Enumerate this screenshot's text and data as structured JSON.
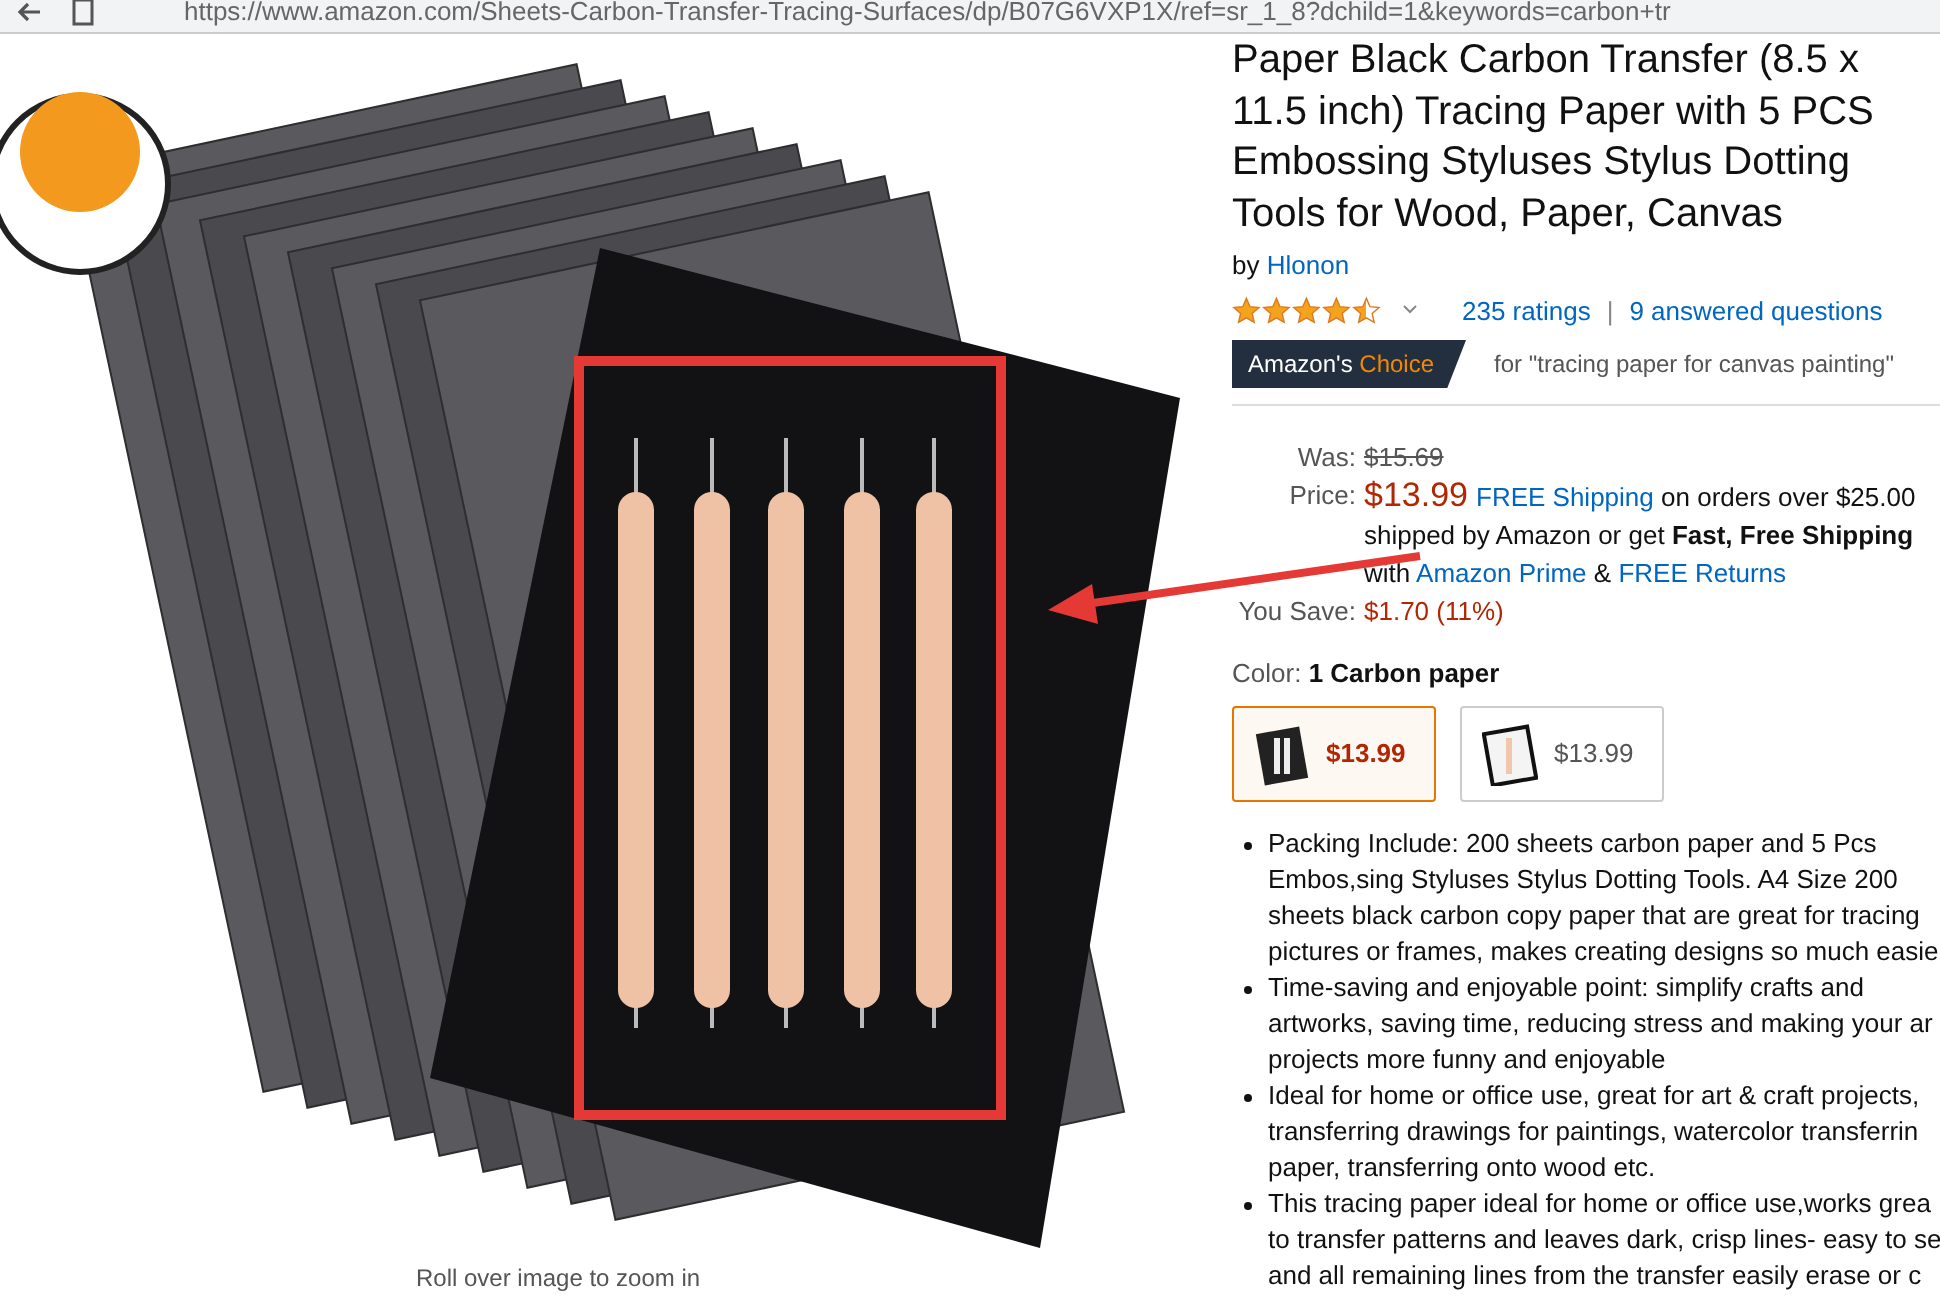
{
  "address_bar": {
    "url": "https://www.amazon.com/Sheets-Carbon-Transfer-Tracing-Surfaces/dp/B07G6VXP1X/ref=sr_1_8?dchild=1&keywords=carbon+tr"
  },
  "image": {
    "caption": "Roll over image to zoom in"
  },
  "product": {
    "title": "Paper Black Carbon Transfer (8.5 x 11.5 inch) Tracing Paper with 5 PCS Embossing Styluses Stylus Dotting Tools for Wood, Paper, Canvas",
    "by": "by",
    "brand": "Hlonon",
    "stars": 4.5,
    "ratings": "235 ratings",
    "separator": "|",
    "questions": "9 answered questions",
    "badge_prefix": "Amazon's",
    "badge_highlight": "Choice",
    "badge_for": "for \"tracing paper for canvas painting\""
  },
  "pricing": {
    "was_label": "Was:",
    "was": "$15.69",
    "price_label": "Price:",
    "price": "$13.99",
    "shipping_link": "FREE Shipping",
    "shipping_text": "on orders over $25.00",
    "shipping_more": "shipped by Amazon or get **Fast, Free Shipping** with",
    "prime_link": "Amazon Prime",
    "amp": "&",
    "returns_link": "FREE Returns",
    "save_label": "You Save:",
    "save": "$1.70 (11%)"
  },
  "color": {
    "label": "Color:",
    "value": "1 Carbon paper",
    "options": [
      {
        "kind": "black",
        "price": "$13.99",
        "selected": true
      },
      {
        "kind": "white",
        "price": "$13.99",
        "selected": false
      }
    ]
  },
  "bullets": [
    [
      "Packing Include: 200 sheets carbon paper and 5 Pcs",
      "Embos,sing Styluses Stylus Dotting Tools. A4 Size 200",
      "sheets black carbon copy paper that are great for tracing",
      "pictures or frames, makes creating designs so much easie"
    ],
    [
      "Time-saving and enjoyable point: simplify crafts and",
      "artworks, saving time, reducing stress and making your ar",
      "projects more funny and enjoyable"
    ],
    [
      "Ideal for home or office use, great for art & craft projects,",
      "transferring drawings for paintings, watercolor transferrin",
      "paper, transferring onto wood etc."
    ],
    [
      "This tracing paper ideal for home or office use,works grea",
      "to transfer patterns and leaves dark, crisp lines- easy to se",
      "and all remaining lines from the transfer easily erase or c"
    ]
  ]
}
